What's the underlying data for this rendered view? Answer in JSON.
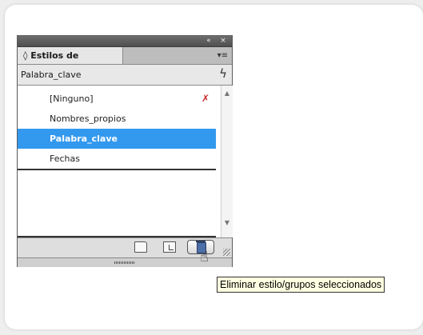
{
  "panel": {
    "collapse_icon": "«",
    "close_icon": "×",
    "tab_label": "◊ Estilos de carácter",
    "menu_icon": "▾≡",
    "current_style": "Palabra_clave",
    "quick_apply_icon": "lightning-bolt",
    "styles": [
      {
        "label": "[Ninguno]",
        "locked_icon": "pencil-crossed-out"
      },
      {
        "label": "Nombres_propios"
      },
      {
        "label": "Palabra_clave",
        "selected": true
      },
      {
        "label": "Fechas"
      }
    ],
    "footer_icons": [
      "folder-icon",
      "new-style-icon",
      "trash-icon"
    ]
  },
  "tooltip": {
    "text": "Eliminar estilo/grupos seleccionados"
  },
  "colors": {
    "selection": "#3399ee",
    "tooltip_bg": "#ffffe1"
  }
}
